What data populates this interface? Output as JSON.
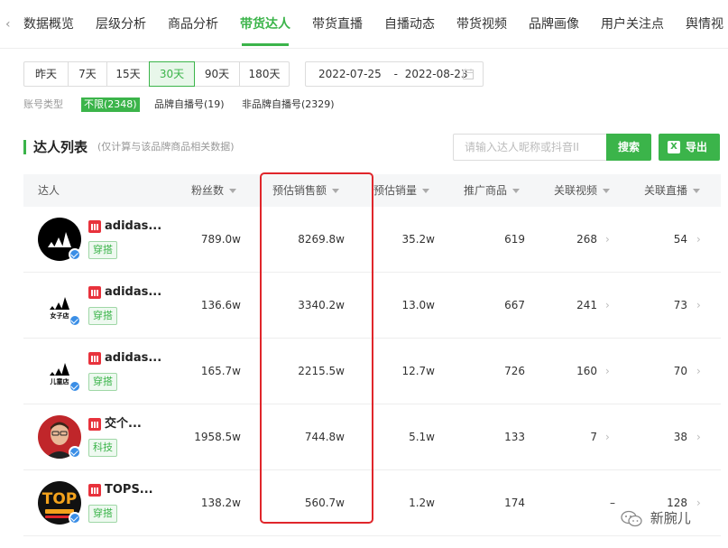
{
  "nav": {
    "tabs": [
      "数据概览",
      "层级分析",
      "商品分析",
      "带货达人",
      "带货直播",
      "自播动态",
      "带货视频",
      "品牌画像",
      "用户关注点",
      "舆情视"
    ],
    "active_index": 3
  },
  "date_filter": {
    "presets": [
      "昨天",
      "7天",
      "15天",
      "30天",
      "90天",
      "180天"
    ],
    "active": "30天",
    "range_start": "2022-07-25",
    "range_sep": "-",
    "range_end": "2022-08-23"
  },
  "account_type": {
    "label": "账号类型",
    "options": [
      "不限(2348)",
      "品牌自播号(19)",
      "非品牌自播号(2329)"
    ],
    "active": "不限(2348)"
  },
  "section": {
    "title": "达人列表",
    "subtitle": "(仅计算与该品牌商品相关数据)",
    "search_placeholder": "请输入达人昵称或抖音II",
    "search_label": "搜索",
    "export_label": "导出"
  },
  "table": {
    "columns": [
      "达人",
      "粉丝数",
      "预估销售额",
      "预估销量",
      "推广商品",
      "关联视频",
      "关联直播"
    ],
    "rows": [
      {
        "name": "adidas...",
        "tag": "穿搭",
        "fans": "789.0w",
        "sales_amount": "8269.8w",
        "sales_volume": "35.2w",
        "products": "619",
        "videos": "268",
        "lives": "54",
        "avatar": "adidas-black-icon"
      },
      {
        "name": "adidas...",
        "tag": "穿搭",
        "fans": "136.6w",
        "sales_amount": "3340.2w",
        "sales_volume": "13.0w",
        "products": "667",
        "videos": "241",
        "lives": "73",
        "avatar": "adidas-women-store-icon",
        "avatar_text": "女子店"
      },
      {
        "name": "adidas...",
        "tag": "穿搭",
        "fans": "165.7w",
        "sales_amount": "2215.5w",
        "sales_volume": "12.7w",
        "products": "726",
        "videos": "160",
        "lives": "70",
        "avatar": "adidas-kids-store-icon",
        "avatar_text": "儿童店"
      },
      {
        "name": "交个...",
        "tag": "科技",
        "fans": "1958.5w",
        "sales_amount": "744.8w",
        "sales_volume": "5.1w",
        "products": "133",
        "videos": "7",
        "lives": "38",
        "avatar": "person-avatar-icon"
      },
      {
        "name": "TOPS...",
        "tag": "穿搭",
        "fans": "138.2w",
        "sales_amount": "560.7w",
        "sales_volume": "1.2w",
        "products": "174",
        "videos": "–",
        "lives": "128",
        "avatar": "topsports-logo-icon",
        "avatar_text": "TOP"
      }
    ]
  },
  "watermark": {
    "text": "新腕儿",
    "icon": "wechat-icon"
  },
  "colors": {
    "accent": "#3bb44a",
    "highlight": "#e0262b",
    "verify": "#3a8ee6",
    "platform": "#e8323c"
  }
}
